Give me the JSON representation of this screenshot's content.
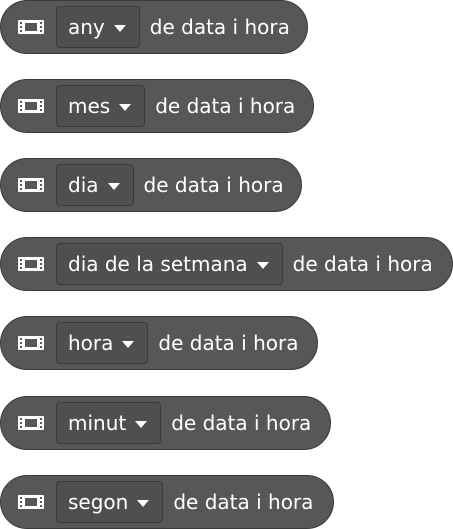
{
  "suffix": "de data i hora",
  "blocks": [
    {
      "option": "any"
    },
    {
      "option": "mes"
    },
    {
      "option": "dia"
    },
    {
      "option": "dia de la setmana"
    },
    {
      "option": "hora"
    },
    {
      "option": "minut"
    },
    {
      "option": "segon"
    }
  ],
  "colors": {
    "block": "#575757",
    "border": "#3b3b3b",
    "text": "#ffffff"
  },
  "icons": {
    "block": "film-strip-icon",
    "dropdown": "caret-down-icon"
  }
}
